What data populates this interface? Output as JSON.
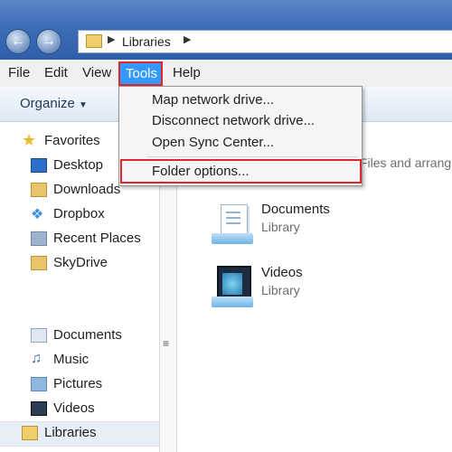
{
  "address_bar": {
    "path": "Libraries"
  },
  "menubar": {
    "file": "File",
    "edit": "Edit",
    "view": "View",
    "tools": "Tools",
    "help": "Help"
  },
  "toolbar": {
    "organize": "Organize"
  },
  "tools_menu": {
    "items": [
      "Map network drive...",
      "Disconnect network drive...",
      "Open Sync Center...",
      "Folder options..."
    ],
    "highlighted": "Folder options..."
  },
  "sidebar": {
    "favorites_label": "Favorites",
    "favorites": [
      "Desktop",
      "Downloads",
      "Dropbox",
      "Recent Places",
      "SkyDrive"
    ],
    "libraries_label": "Libraries",
    "libraries": [
      "Documents",
      "Music",
      "Pictures",
      "Videos"
    ]
  },
  "content": {
    "hint_fragment": "Files and arrang",
    "items": [
      {
        "name": "Documents",
        "type": "Library"
      },
      {
        "name": "Videos",
        "type": "Library"
      }
    ]
  },
  "colors": {
    "highlight": "#3399ff",
    "annotation_red": "#e0262b",
    "title_blue": "#3d6db8"
  }
}
